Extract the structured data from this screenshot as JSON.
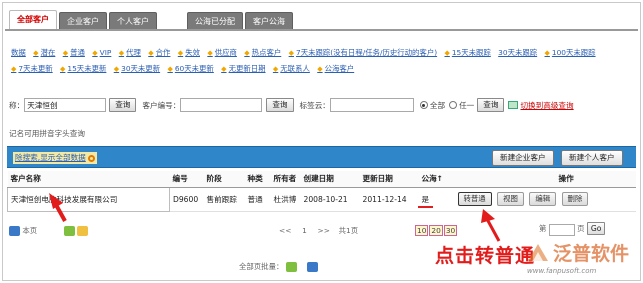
{
  "tabs": [
    "全部客户",
    "企业客户",
    "个人客户",
    "公海已分配",
    "客户公海"
  ],
  "filters": [
    "数据",
    "潜在",
    "普通",
    "VIP",
    "代理",
    "合作",
    "失效",
    "供应商",
    "热点客户",
    "7天未跟踪(没有日程/任务/历史行动的客户)",
    "15天未跟踪",
    "30天未跟踪",
    "100天未跟踪",
    "7天未更新",
    "15天未更新",
    "30天未更新",
    "60天未更新",
    "无更新日期",
    "无联系人",
    "公海客户"
  ],
  "search": {
    "name_label": "称：",
    "name_value": "天津恒创",
    "query": "查询",
    "code_label": "客户编号：",
    "tag_label": "标签云：",
    "all_label": "全部",
    "any_label": "任一",
    "advanced": "切换到高级查询"
  },
  "hint": "记名可用拼音字头查询",
  "toolbar": {
    "clear": "除搜索,显示全部数据",
    "new_company": "新建企业客户",
    "new_person": "新建个人客户"
  },
  "table": {
    "headers": [
      "客户名称",
      "编号",
      "阶段",
      "种类",
      "所有者",
      "创建日期",
      "更新日期",
      "公海↑",
      "操作"
    ],
    "rows": [
      {
        "name": "天津恒创电脑科技发展有限公司",
        "code": "D9600",
        "stage": "售前跟踪",
        "kind": "普通",
        "owner": "杜洪博",
        "created": "2008-10-21",
        "updated": "2011-12-14",
        "public": "是",
        "actions": [
          "转普通",
          "视图",
          "编辑",
          "删除"
        ]
      }
    ]
  },
  "pager": {
    "this_page": "本页",
    "prev": "<<",
    "page_num": "1",
    "next": ">>",
    "total": "共1页",
    "sizes": [
      "10",
      "20",
      "30"
    ],
    "goto_prefix": "第",
    "goto_suffix": "页",
    "go": "Go"
  },
  "footer": "全部页批量：",
  "caption": "点击转普通",
  "watermark": {
    "name": "泛普软件",
    "url": "www.fanpusoft.com"
  },
  "colors": {
    "toolbar": "#2f86c8",
    "tab_inactive": "#7a7a7a",
    "accent_red": "#e21b1b",
    "link_blue": "#2b5fb3"
  }
}
